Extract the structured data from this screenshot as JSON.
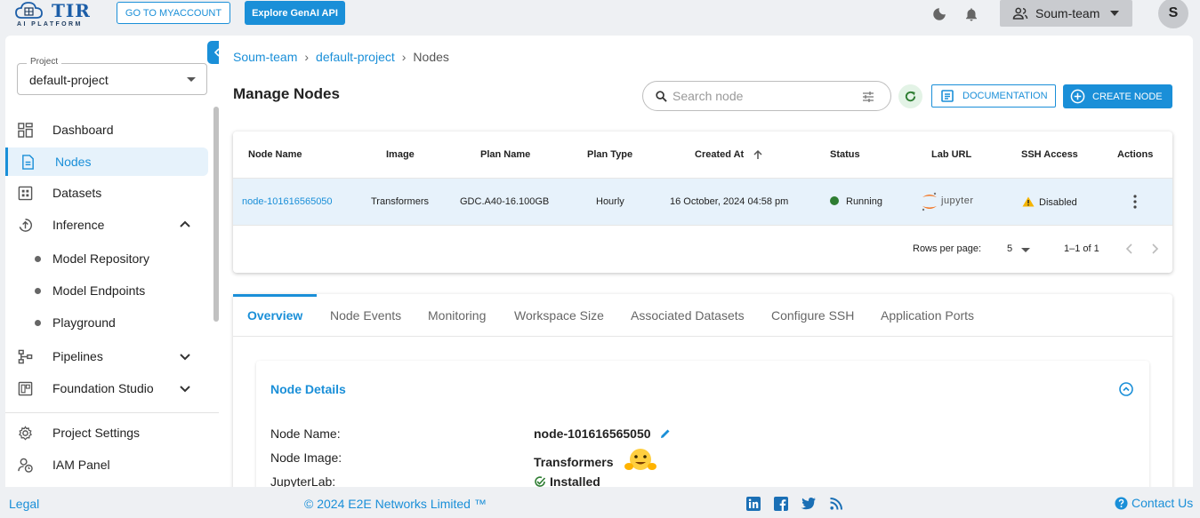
{
  "brand": {
    "name": "TIR",
    "tagline": "AI PLATFORM"
  },
  "topbar": {
    "myaccount_label": "GO TO MYACCOUNT",
    "genai_label": "Explore GenAI API",
    "team_label": "Soum-team",
    "avatar_initial": "S"
  },
  "sidebar": {
    "project_legend": "Project",
    "project_value": "default-project",
    "items": [
      {
        "label": "Dashboard"
      },
      {
        "label": "Nodes"
      },
      {
        "label": "Datasets"
      },
      {
        "label": "Inference"
      },
      {
        "label": "Pipelines"
      },
      {
        "label": "Foundation Studio"
      },
      {
        "label": "Project Settings"
      },
      {
        "label": "IAM Panel"
      }
    ],
    "inference_sub": [
      {
        "label": "Model Repository"
      },
      {
        "label": "Model Endpoints"
      },
      {
        "label": "Playground"
      }
    ]
  },
  "breadcrumb": {
    "team": "Soum-team",
    "project": "default-project",
    "current": "Nodes"
  },
  "page": {
    "title": "Manage Nodes",
    "search_placeholder": "Search node",
    "documentation_label": "DOCUMENTATION",
    "create_label": "CREATE NODE"
  },
  "table": {
    "headers": [
      "Node Name",
      "Image",
      "Plan Name",
      "Plan Type",
      "Created At",
      "Status",
      "Lab URL",
      "SSH Access",
      "Actions"
    ],
    "rows": [
      {
        "node_name": "node-101616565050",
        "image": "Transformers",
        "plan_name": "GDC.A40-16.100GB",
        "plan_type": "Hourly",
        "created_at": "16 October, 2024 04:58 pm",
        "status": "Running",
        "lab_url": "jupyter",
        "ssh_access": "Disabled"
      }
    ],
    "rows_per_page_label": "Rows per page:",
    "rows_per_page_value": "5",
    "range": "1–1 of 1"
  },
  "tabs": [
    "Overview",
    "Node Events",
    "Monitoring",
    "Workspace Size",
    "Associated Datasets",
    "Configure SSH",
    "Application Ports"
  ],
  "details": {
    "title": "Node Details",
    "fields": [
      {
        "label": "Node Name:",
        "value": "node-101616565050"
      },
      {
        "label": "Node Image:",
        "value": "Transformers"
      },
      {
        "label": "JupyterLab:",
        "value": "Installed"
      }
    ]
  },
  "footer": {
    "legal": "Legal",
    "copyright": "© 2024 E2E Networks Limited ™",
    "contact": "Contact Us"
  },
  "colors": {
    "accent": "#1a8fd8",
    "running": "#2e7d32",
    "warning": "#f5b400",
    "jupyter_orange": "#f37726"
  }
}
